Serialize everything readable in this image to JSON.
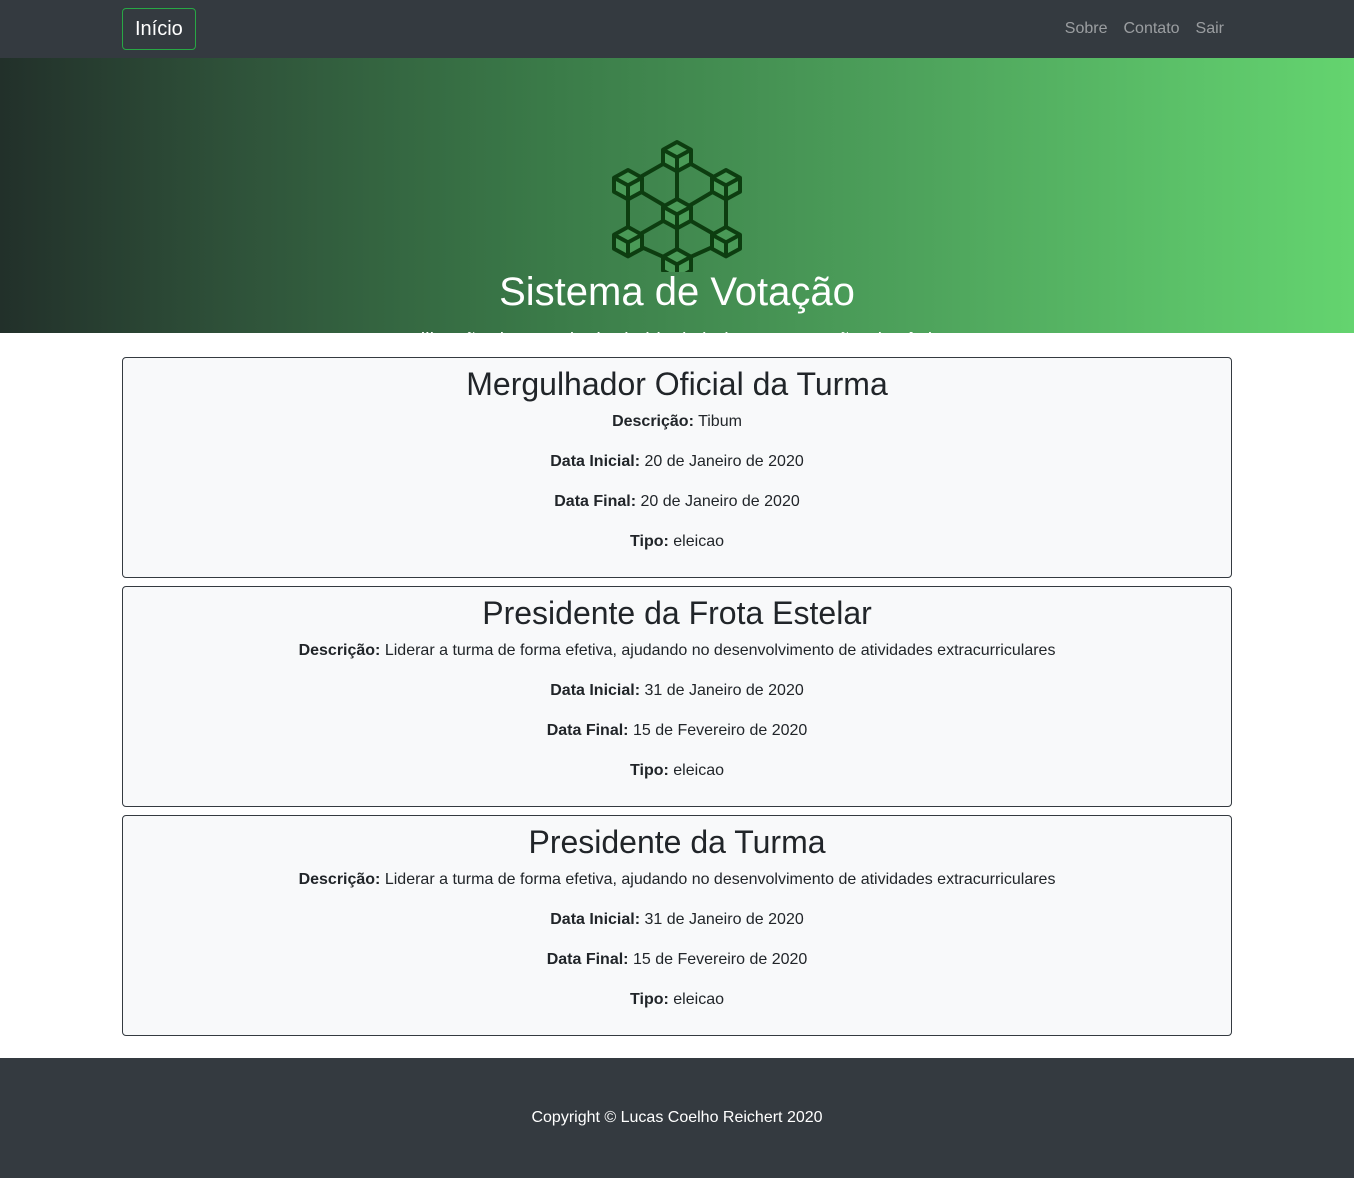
{
  "navbar": {
    "brand": "Início",
    "links": [
      "Sobre",
      "Contato",
      "Sair"
    ]
  },
  "hero": {
    "title": "Sistema de Votação",
    "subtitle": "Utilização da tecnologia de blockchain para votação eletrônica",
    "logo_icon": "blockchain-cubes-icon"
  },
  "labels": {
    "description": "Descrição:",
    "start_date": "Data Inicial:",
    "end_date": "Data Final:",
    "type": "Tipo:"
  },
  "elections": [
    {
      "title": "Mergulhador Oficial da Turma",
      "description": "Tibum",
      "start_date": "20 de Janeiro de 2020",
      "end_date": "20 de Janeiro de 2020",
      "type": "eleicao"
    },
    {
      "title": "Presidente da Frota Estelar",
      "description": "Liderar a turma de forma efetiva, ajudando no desenvolvimento de atividades extracurriculares",
      "start_date": "31 de Janeiro de 2020",
      "end_date": "15 de Fevereiro de 2020",
      "type": "eleicao"
    },
    {
      "title": "Presidente da Turma",
      "description": "Liderar a turma de forma efetiva, ajudando no desenvolvimento de atividades extracurriculares",
      "start_date": "31 de Janeiro de 2020",
      "end_date": "15 de Fevereiro de 2020",
      "type": "eleicao"
    }
  ],
  "footer": {
    "copyright": "Copyright © Lucas Coelho Reichert 2020"
  },
  "colors": {
    "navbar_bg": "#343a40",
    "brand_border": "#28a745",
    "card_bg": "#f8f9fa",
    "logo_stroke": "#0d3d10"
  }
}
